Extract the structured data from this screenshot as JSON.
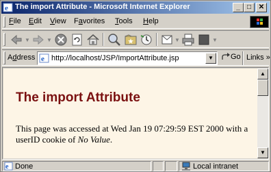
{
  "window": {
    "title": "The import Attribute - Microsoft Internet Explorer",
    "minimize_label": "_",
    "maximize_label": "□",
    "close_label": "✕"
  },
  "menu": {
    "items": [
      {
        "accel": "F",
        "rest": "ile"
      },
      {
        "accel": "E",
        "rest": "dit"
      },
      {
        "accel": "V",
        "rest": "iew"
      },
      {
        "pre": "F",
        "accel": "a",
        "rest": "vorites"
      },
      {
        "accel": "T",
        "rest": "ools"
      },
      {
        "accel": "H",
        "rest": "elp"
      }
    ]
  },
  "toolbar": {
    "icons": [
      "back-icon",
      "forward-icon",
      "stop-icon",
      "refresh-icon",
      "home-icon",
      "search-icon",
      "favorites-icon",
      "history-icon",
      "mail-icon",
      "print-icon",
      "edit-icon"
    ]
  },
  "address": {
    "label_accel": "d",
    "label_pre": "A",
    "label_rest": "dress",
    "url": "http://localhost/JSP/ImportAttribute.jsp",
    "go_label": "Go",
    "links_label": "Links »"
  },
  "page": {
    "heading": "The import Attribute",
    "text_before": "This page was accessed at Wed Jan 19 07:29:59 EST 2000 with a userID cookie of ",
    "cookie_value": "No Value",
    "text_after": "."
  },
  "status": {
    "left_text": "Done",
    "zone_text": "Local intranet"
  },
  "colors": {
    "heading": "#7a1010",
    "page_background": "#fdf5e6",
    "title_gradient_start": "#0a246a",
    "title_gradient_end": "#a6caf0"
  }
}
